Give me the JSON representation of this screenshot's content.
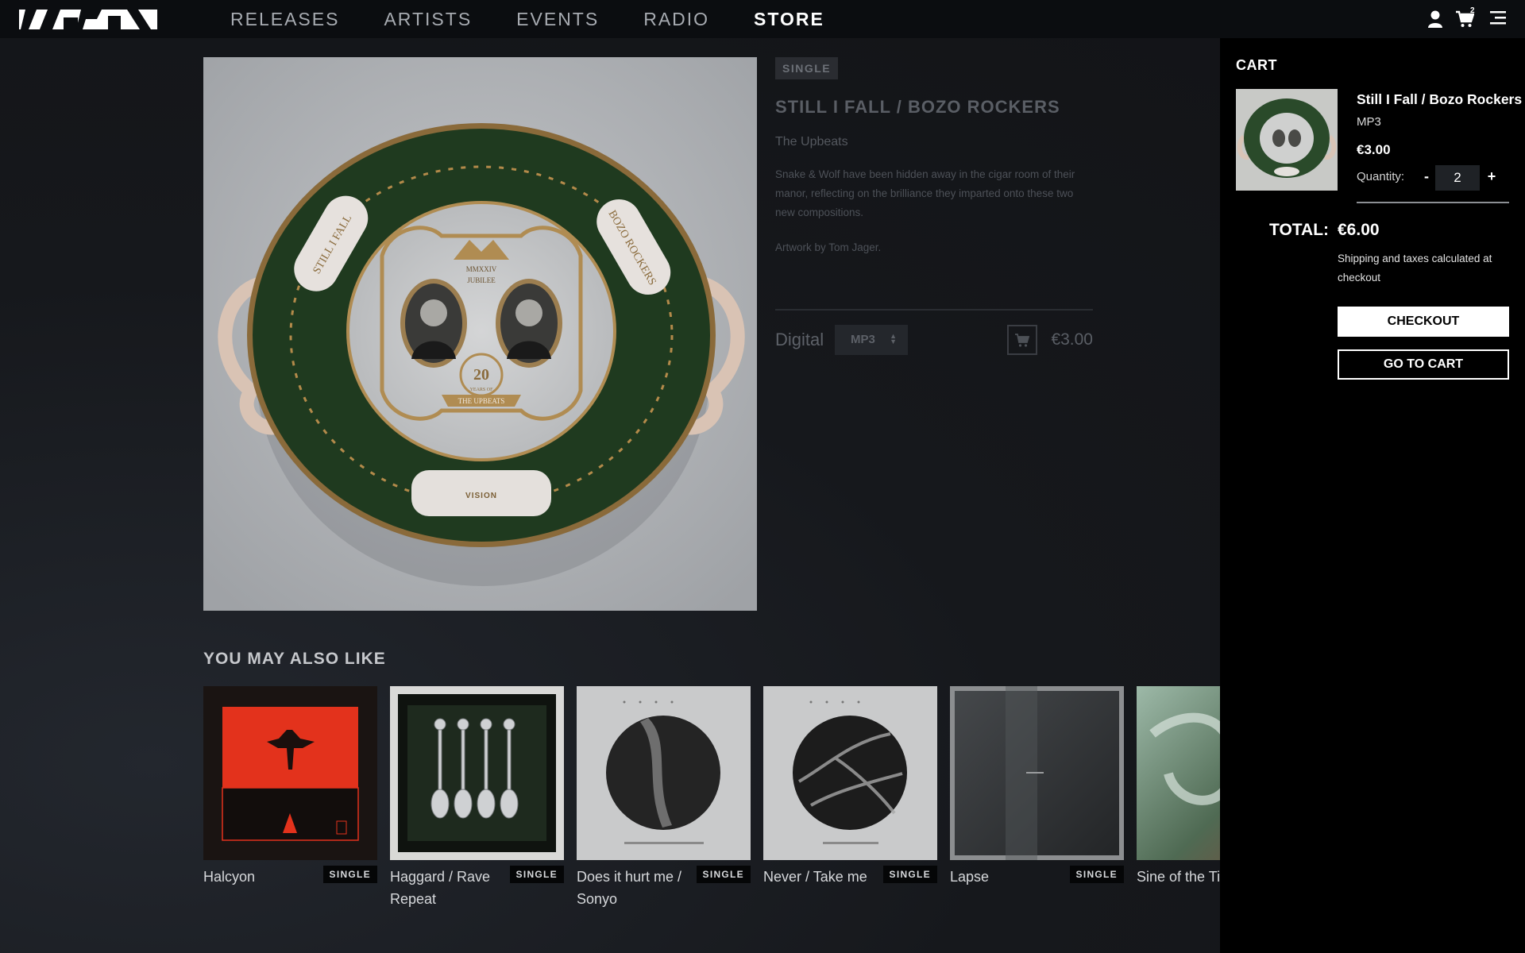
{
  "nav": {
    "logo_alt": "VISION",
    "items": [
      {
        "label": "RELEASES",
        "active": false
      },
      {
        "label": "ARTISTS",
        "active": false
      },
      {
        "label": "EVENTS",
        "active": false
      },
      {
        "label": "RADIO",
        "active": false
      },
      {
        "label": "STORE",
        "active": true
      }
    ],
    "cart_count": "2",
    "icons": [
      "user-icon",
      "cart-icon",
      "menu-icon"
    ]
  },
  "product": {
    "type_tag": "SINGLE",
    "title": "STILL I FALL / BOZO ROCKERS",
    "artist": "The Upbeats",
    "description": "Snake & Wolf have been hidden away in the cigar room of their manor, reflecting on the brilliance they imparted onto these two new compositions.",
    "credit": "Artwork by Tom Jager.",
    "buy_label": "Digital",
    "format_value": "MP3",
    "price": "€3.00",
    "cover_text": {
      "left_banner": "STILL I FALL",
      "right_banner": "BOZO ROCKERS",
      "crest_top": "MMXXIV",
      "crest_sub": "JUBILEE",
      "badge_num": "20",
      "badge_line": "YEARS OF",
      "badge_ribbon": "THE UPBEATS",
      "bottom_mark": "VISION"
    }
  },
  "also": {
    "title": "YOU MAY ALSO LIKE",
    "items": [
      {
        "name": "Halcyon",
        "tag": "SINGLE",
        "art": "red-eagle"
      },
      {
        "name": "Haggard / Rave Repeat",
        "tag": "SINGLE",
        "art": "spoons"
      },
      {
        "name": "Does it hurt me / Sonyo",
        "tag": "SINGLE",
        "art": "grey-circle"
      },
      {
        "name": "Never / Take me",
        "tag": "SINGLE",
        "art": "marble-circle"
      },
      {
        "name": "Lapse",
        "tag": "SINGLE",
        "art": "dark-fog"
      },
      {
        "name": "Sine of the Tin",
        "tag": "",
        "art": "green-abstract"
      }
    ]
  },
  "cart": {
    "title": "CART",
    "item": {
      "name": "Still I Fall / Bozo Rockers",
      "format": "MP3",
      "price": "€3.00",
      "quantity_label": "Quantity:",
      "quantity": "2",
      "minus": "-",
      "plus": "+"
    },
    "total_label": "TOTAL:",
    "total_value": "€6.00",
    "shipping_note": "Shipping and taxes calculated at checkout",
    "checkout_label": "CHECKOUT",
    "gotocart_label": "GO TO CART"
  },
  "colors": {
    "background": "#15171b",
    "topbar": "#0b0d10",
    "cart_panel": "#000000",
    "plate_green": "#1f3a1f",
    "plate_gold": "#b38a4a",
    "halcyon_red": "#e3321c"
  }
}
